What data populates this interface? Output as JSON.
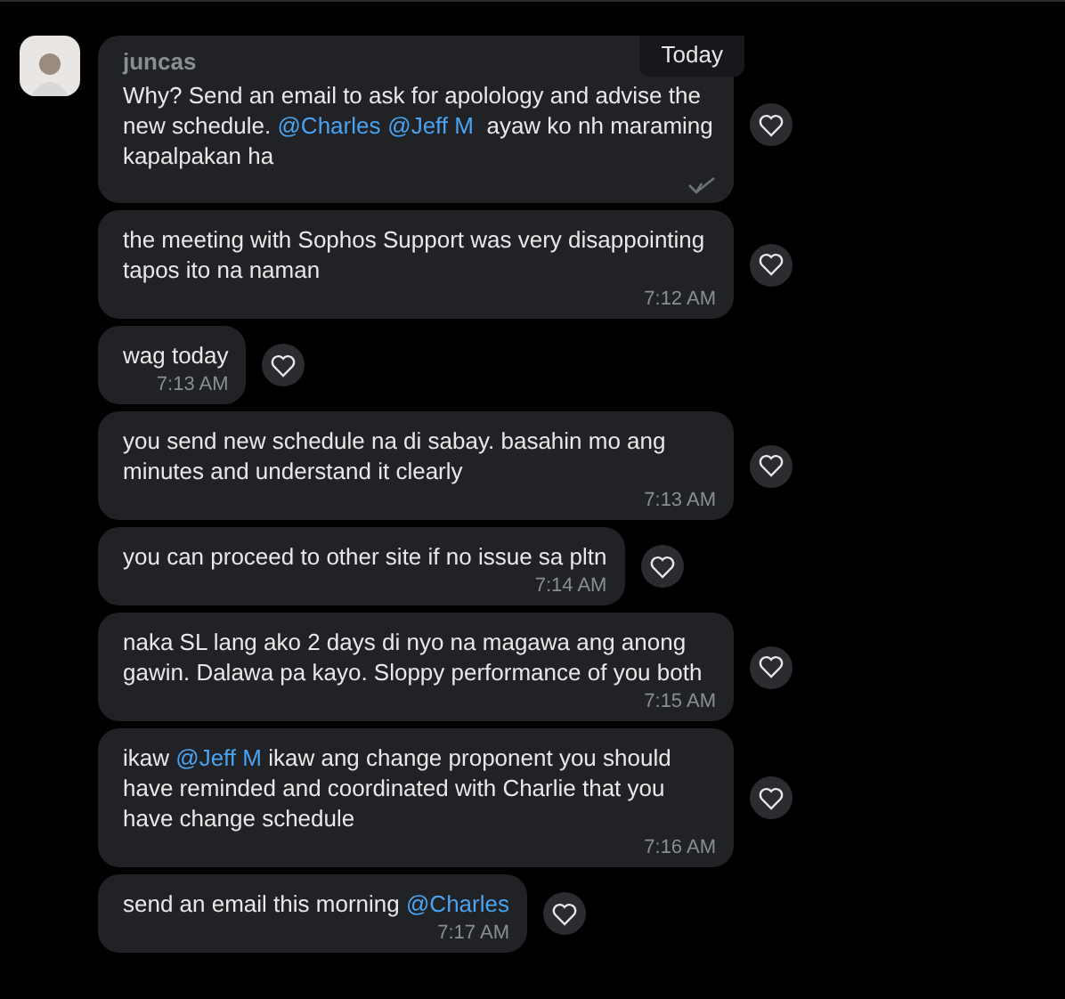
{
  "sender": {
    "name": "juncas"
  },
  "date_badge": "Today",
  "messages": [
    {
      "parts": [
        {
          "kind": "text",
          "text": "Why? Send an email to ask for apolology and advise the new schedule. "
        },
        {
          "kind": "mention",
          "text": "@Charles"
        },
        {
          "kind": "mention",
          "text": "@Jeff M"
        },
        {
          "kind": "text",
          "text": "  ayaw ko nh maraming kapalpakan ha"
        }
      ],
      "read": true
    },
    {
      "parts": [
        {
          "kind": "text",
          "text": "the meeting with Sophos Support was very disappointing tapos ito na naman"
        }
      ],
      "time": "7:12 AM"
    },
    {
      "parts": [
        {
          "kind": "text",
          "text": "wag today"
        }
      ],
      "time": "7:13 AM"
    },
    {
      "parts": [
        {
          "kind": "text",
          "text": "you send new schedule na di sabay. basahin mo ang minutes and understand it clearly"
        }
      ],
      "time": "7:13 AM"
    },
    {
      "parts": [
        {
          "kind": "text",
          "text": "you can proceed to other site if no issue sa pltn"
        }
      ],
      "time": "7:14 AM"
    },
    {
      "parts": [
        {
          "kind": "text",
          "text": "naka SL lang ako 2 days di nyo na magawa ang anong gawin. Dalawa pa kayo. Sloppy performance of you both"
        }
      ],
      "time": "7:15 AM"
    },
    {
      "parts": [
        {
          "kind": "text",
          "text": "ikaw "
        },
        {
          "kind": "mention",
          "text": "@Jeff M"
        },
        {
          "kind": "text",
          "text": " ikaw ang change proponent you should have reminded and coordinated with Charlie that you have change schedule"
        }
      ],
      "time": "7:16 AM"
    },
    {
      "parts": [
        {
          "kind": "text",
          "text": "send an email this morning "
        },
        {
          "kind": "mention",
          "text": "@Charles"
        }
      ],
      "time": "7:17 AM"
    }
  ]
}
